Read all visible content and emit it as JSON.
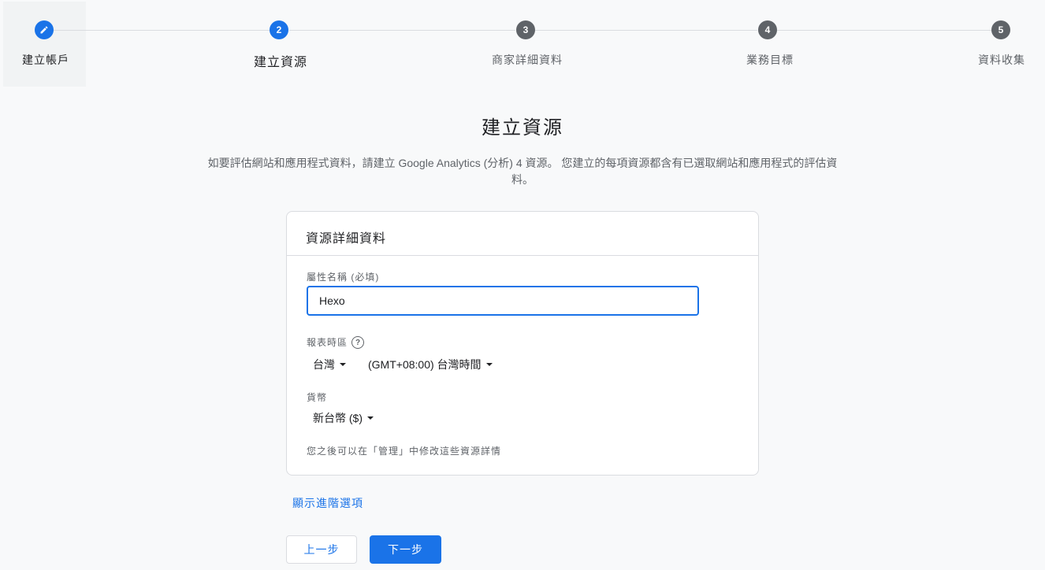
{
  "stepper": {
    "steps": [
      {
        "number": "",
        "label": "建立帳戶",
        "state": "completed"
      },
      {
        "number": "2",
        "label": "建立資源",
        "state": "current"
      },
      {
        "number": "3",
        "label": "商家詳細資料",
        "state": "upcoming"
      },
      {
        "number": "4",
        "label": "業務目標",
        "state": "upcoming"
      },
      {
        "number": "5",
        "label": "資料收集",
        "state": "upcoming"
      }
    ],
    "completed_icon": "pencil-icon"
  },
  "page": {
    "title": "建立資源",
    "description": "如要評估網站和應用程式資料，請建立 Google Analytics (分析) 4 資源。 您建立的每項資源都含有已選取網站和應用程式的評估資料。"
  },
  "card": {
    "header": "資源詳細資料",
    "property_name": {
      "label": "屬性名稱 (必填)",
      "value": "Hexo"
    },
    "timezone": {
      "label": "報表時區",
      "help_icon": "help-circle-icon",
      "country": "台灣",
      "zone": "(GMT+08:00) 台灣時間"
    },
    "currency": {
      "label": "貨幣",
      "value": "新台幣 ($)"
    },
    "footnote": "您之後可以在「管理」中修改這些資源詳情"
  },
  "advanced_link": "顯示進階選項",
  "buttons": {
    "back": "上一步",
    "next": "下一步"
  },
  "colors": {
    "accent": "#1a73e8",
    "inactive_step": "#5f6368"
  }
}
